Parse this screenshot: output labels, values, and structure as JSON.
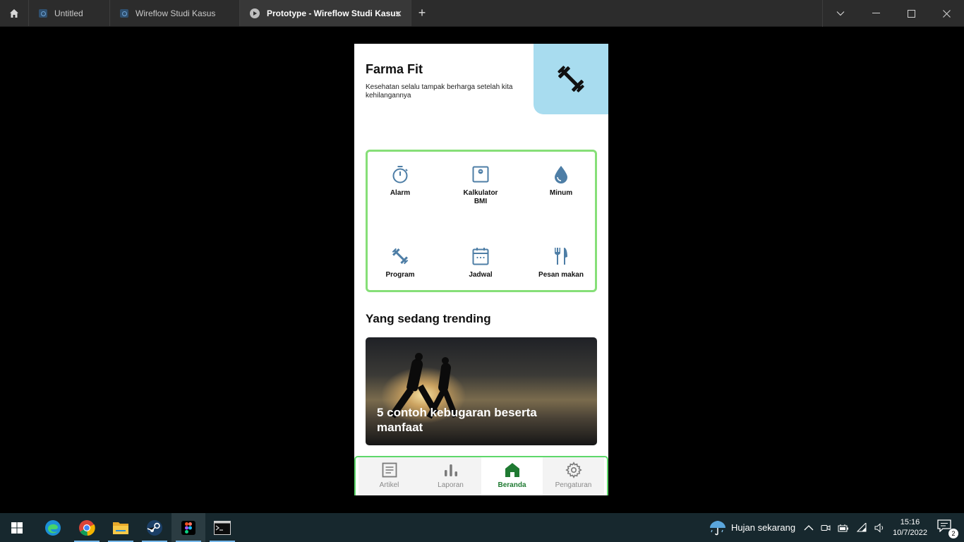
{
  "window": {
    "tabs": [
      {
        "label": "Untitled",
        "icon": "figma-file-icon"
      },
      {
        "label": "Wireflow Studi Kasus",
        "icon": "figma-file-icon"
      },
      {
        "label": "Prototype - Wireflow Studi Kasus",
        "icon": "play-icon",
        "active": true
      }
    ],
    "close_glyph": "✕",
    "new_tab_glyph": "+"
  },
  "app": {
    "title": "Farma Fit",
    "subtitle": "Kesehatan selalu tampak berharga setelah kita kehilangannya",
    "hero_icon": "dumbbell-icon",
    "accent": "#4e7ea6",
    "menu": [
      {
        "label": "Alarm",
        "icon": "stopwatch-icon"
      },
      {
        "label": "Kalkulator BMI",
        "icon": "scale-icon"
      },
      {
        "label": "Minum",
        "icon": "water-drop-icon"
      },
      {
        "label": "Program",
        "icon": "dumbbell-icon"
      },
      {
        "label": "Jadwal",
        "icon": "calendar-icon"
      },
      {
        "label": "Pesan makan",
        "icon": "utensils-icon"
      }
    ],
    "trending": {
      "title": "Yang sedang trending",
      "card_title": "5 contoh kebugaran beserta manfaat"
    },
    "nav": [
      {
        "label": "Artikel",
        "icon": "article-icon"
      },
      {
        "label": "Laporan",
        "icon": "bar-chart-icon"
      },
      {
        "label": "Beranda",
        "icon": "home-icon",
        "active": true
      },
      {
        "label": "Pengaturan",
        "icon": "gear-icon"
      }
    ]
  },
  "taskbar": {
    "weather": "Hujan sekarang",
    "time": "15:16",
    "date": "10/7/2022",
    "notification_count": "2"
  }
}
